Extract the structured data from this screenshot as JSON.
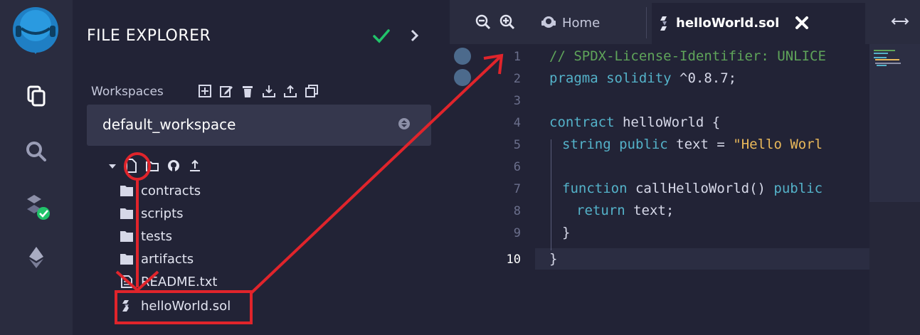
{
  "explorer": {
    "title": "FILE EXPLORER",
    "workspaces_label": "Workspaces",
    "workspace_selected": "default_workspace",
    "tree": [
      {
        "type": "folder",
        "label": "contracts"
      },
      {
        "type": "folder",
        "label": "scripts"
      },
      {
        "type": "folder",
        "label": "tests"
      },
      {
        "type": "folder",
        "label": "artifacts"
      },
      {
        "type": "file",
        "label": "README.txt"
      },
      {
        "type": "sol",
        "label": "helloWorld.sol"
      }
    ]
  },
  "tabs": [
    {
      "label": "Home",
      "active": false
    },
    {
      "label": "helloWorld.sol",
      "active": true
    }
  ],
  "editor": {
    "line_numbers": [
      "1",
      "2",
      "3",
      "4",
      "5",
      "6",
      "7",
      "8",
      "9",
      "10"
    ],
    "current_line": "10",
    "code": {
      "l1": "// SPDX-License-Identifier: UNLICE",
      "l2_kw": "pragma solidity",
      "l2_rest": " ^0.8.7;",
      "l4_kw": "contract",
      "l4_rest": " helloWorld {",
      "l5_type": "string",
      "l5_kw": "public",
      "l5_mid": " text = ",
      "l5_str": "\"Hello Worl",
      "l7_kw": "function",
      "l7_mid": " callHelloWorld() ",
      "l7_kw2": "public",
      "l8_kw": "return",
      "l8_rest": " text;",
      "l9": "}",
      "l10": "}"
    }
  },
  "colors": {
    "accent_green": "#21c36a",
    "annotation_red": "#e0242b",
    "panel_bg": "#222336",
    "iconbar_bg": "#2a2c3f"
  }
}
